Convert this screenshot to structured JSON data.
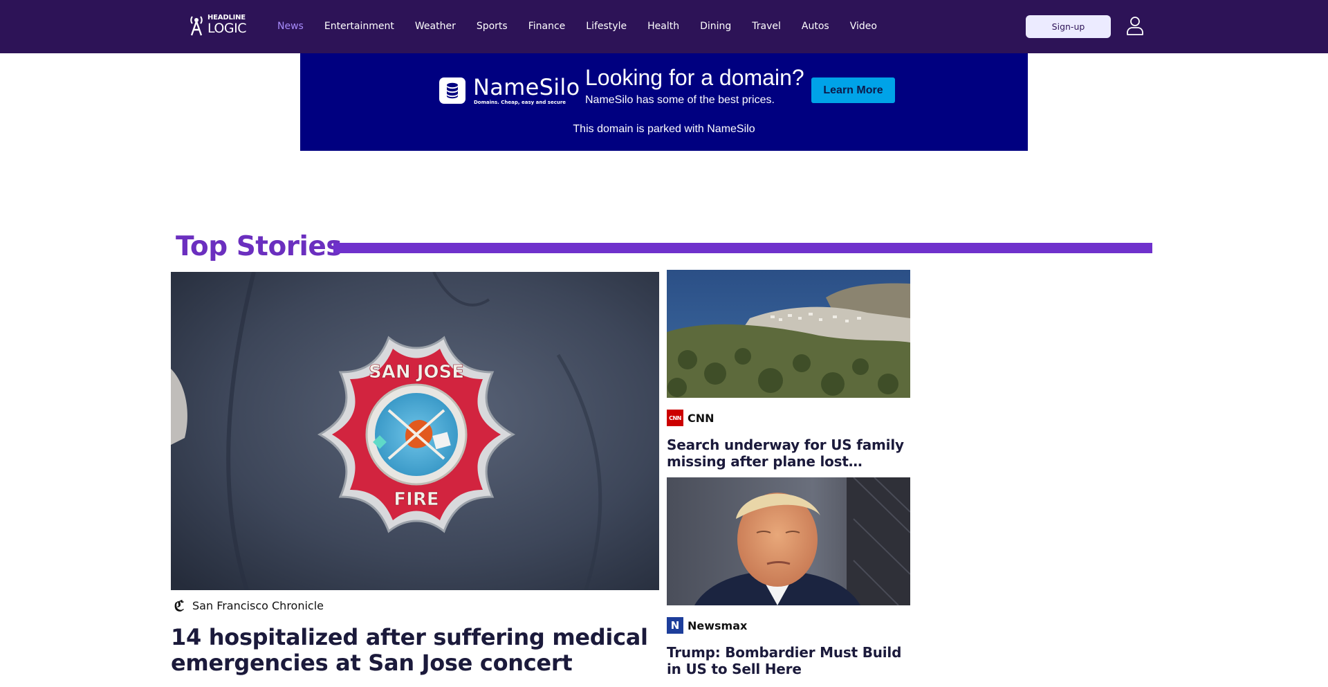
{
  "header": {
    "logo_line1": "HEADLINE",
    "logo_line2": "LOGIC",
    "nav": [
      {
        "label": "News",
        "active": true
      },
      {
        "label": "Entertainment"
      },
      {
        "label": "Weather"
      },
      {
        "label": "Sports"
      },
      {
        "label": "Finance"
      },
      {
        "label": "Lifestyle"
      },
      {
        "label": "Health"
      },
      {
        "label": "Dining"
      },
      {
        "label": "Travel"
      },
      {
        "label": "Autos"
      },
      {
        "label": "Video"
      }
    ],
    "signup_label": "Sign-up",
    "user_icon": "user-icon",
    "bg_color": "#2d1357",
    "active_color": "#a78bfa"
  },
  "ad": {
    "brand": "NameSilo",
    "tagline": "Domains. Cheap, easy and secure",
    "headline": "Looking for a domain?",
    "subtext": "NameSilo has some of the best prices.",
    "button_label": "Learn More",
    "parked_text": "This domain is parked with NameSilo",
    "bg_color": "#000080",
    "button_color": "#00a3e8"
  },
  "top_stories": {
    "title": "Top Stories",
    "accent_color": "#6f31cc",
    "lead": {
      "source": "San Francisco Chronicle",
      "headline": "14 hospitalized after suffering medical emergencies at San Jose concert",
      "image_patch_top": "SAN JOSE",
      "image_patch_bottom": "FIRE"
    },
    "cards": [
      {
        "source": "CNN",
        "badge": "CNN",
        "headline": "Search underway for US family missing after plane lost contact…"
      },
      {
        "source": "Newsmax",
        "badge": "N",
        "headline": "Trump: Bombardier Must Build in US to Sell Here"
      }
    ]
  }
}
